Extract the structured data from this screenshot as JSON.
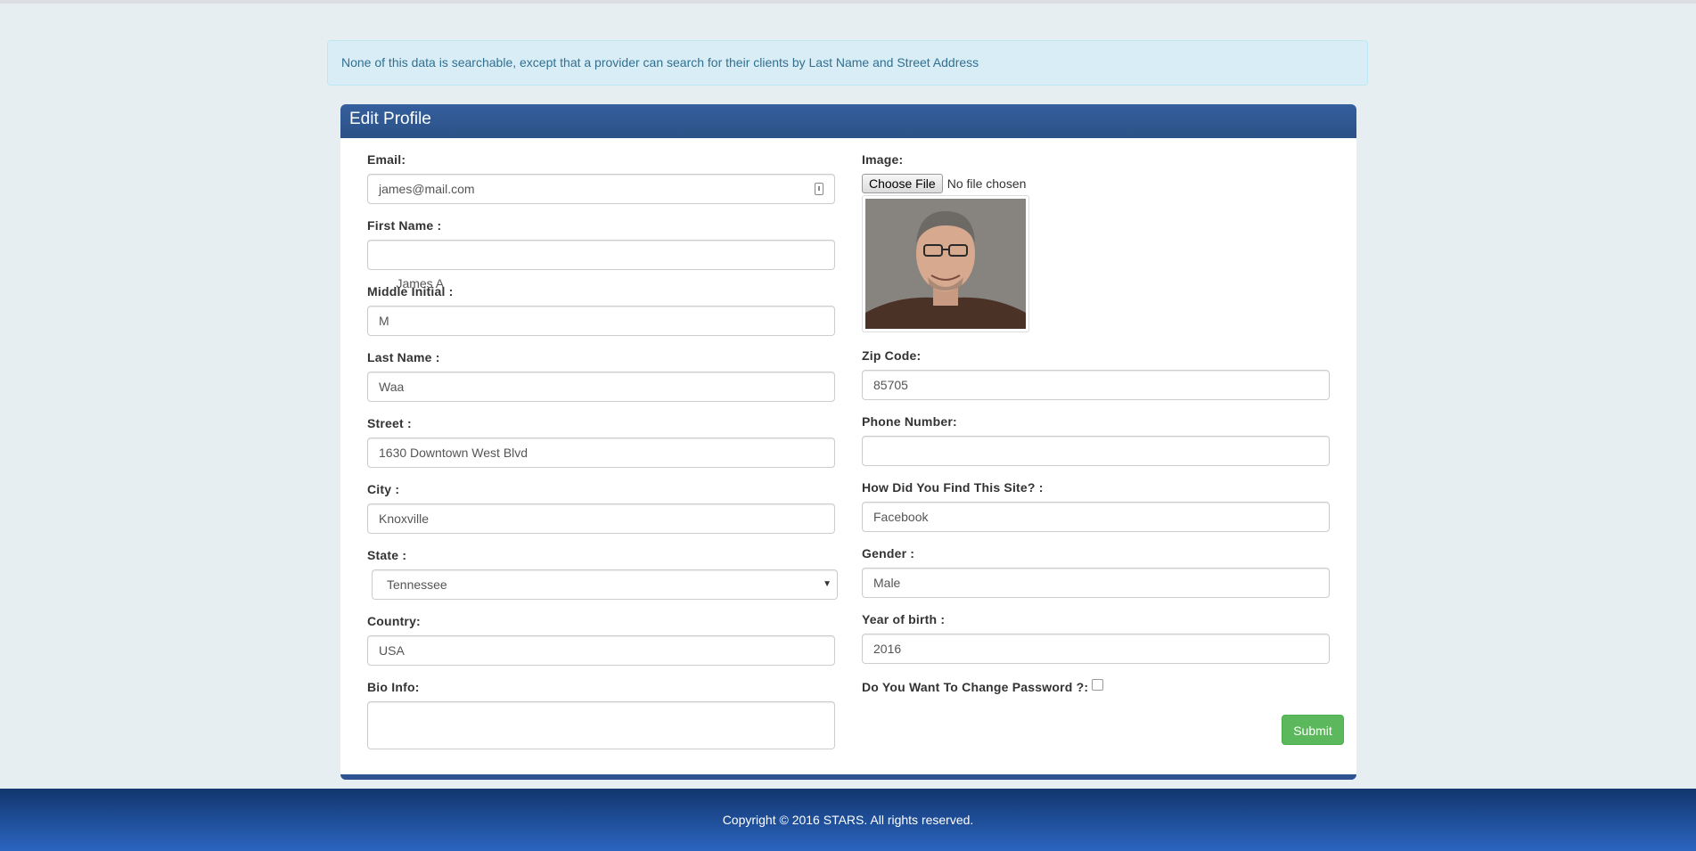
{
  "alert": {
    "text": "None of this data is searchable, except that a provider can search for their clients by Last Name and Street Address"
  },
  "panel": {
    "title": "Edit Profile"
  },
  "form": {
    "email": {
      "label": "Email:",
      "value": "james@mail.com"
    },
    "first_name": {
      "label": "First Name :",
      "value": " James A"
    },
    "middle_initial": {
      "label": "Middle Initial :",
      "value": "M"
    },
    "last_name": {
      "label": "Last Name :",
      "value": "Waa"
    },
    "street": {
      "label": "Street :",
      "value": "1630 Downtown West Blvd"
    },
    "city": {
      "label": "City :",
      "value": "Knoxville"
    },
    "state": {
      "label": "State :",
      "value": "Tennessee"
    },
    "country": {
      "label": "Country:",
      "value": "USA"
    },
    "bio": {
      "label": "Bio Info:",
      "value": ""
    },
    "image": {
      "label": "Image:",
      "button": "Choose File",
      "status": "No file chosen"
    },
    "zip": {
      "label": "Zip Code:",
      "value": "85705"
    },
    "phone": {
      "label": "Phone Number:",
      "value": ""
    },
    "referral": {
      "label": "How Did You Find This Site? :",
      "value": "Facebook"
    },
    "gender": {
      "label": "Gender :",
      "value": "Male"
    },
    "birth_year": {
      "label": "Year of birth :",
      "value": "2016"
    },
    "change_password": {
      "label": "Do You Want To Change Password ?:",
      "checked": false
    },
    "submit_label": "Submit"
  },
  "footer": {
    "text": "Copyright © 2016 STARS. All rights reserved."
  },
  "colors": {
    "panel_header": "#2d5491",
    "submit": "#5cb85c",
    "alert_bg": "#d9edf7",
    "footer": "#1d4a94"
  }
}
